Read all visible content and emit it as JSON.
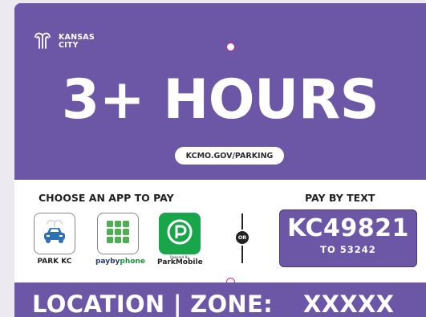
{
  "colors": {
    "sign_purple": "#6c56a6",
    "white": "#ffffff",
    "parkmobile_green": "#19a64a"
  },
  "logo": {
    "line1": "KANSAS",
    "line2": "CITY",
    "icon": "fountain-icon"
  },
  "headline": "3+ HOURS",
  "url": "KCMO.GOV/PARKING",
  "apps": {
    "title": "CHOOSE AN APP TO PAY",
    "items": [
      {
        "label": "PARK KC",
        "icon": "car-icon"
      },
      {
        "label_prefix": "payby",
        "label_suffix": "phone",
        "icon": "keypad-icon"
      },
      {
        "label": "ParkMobile",
        "powered": "Powered By",
        "icon": "parkmobile-p-icon"
      }
    ]
  },
  "divider": {
    "text": "OR"
  },
  "pay_by_text": {
    "title": "PAY BY TEXT",
    "code": "KC49821",
    "to": "TO 53242"
  },
  "bottom_bar": {
    "location": "LOCATION | ZONE:",
    "zone": "XXXXX"
  }
}
